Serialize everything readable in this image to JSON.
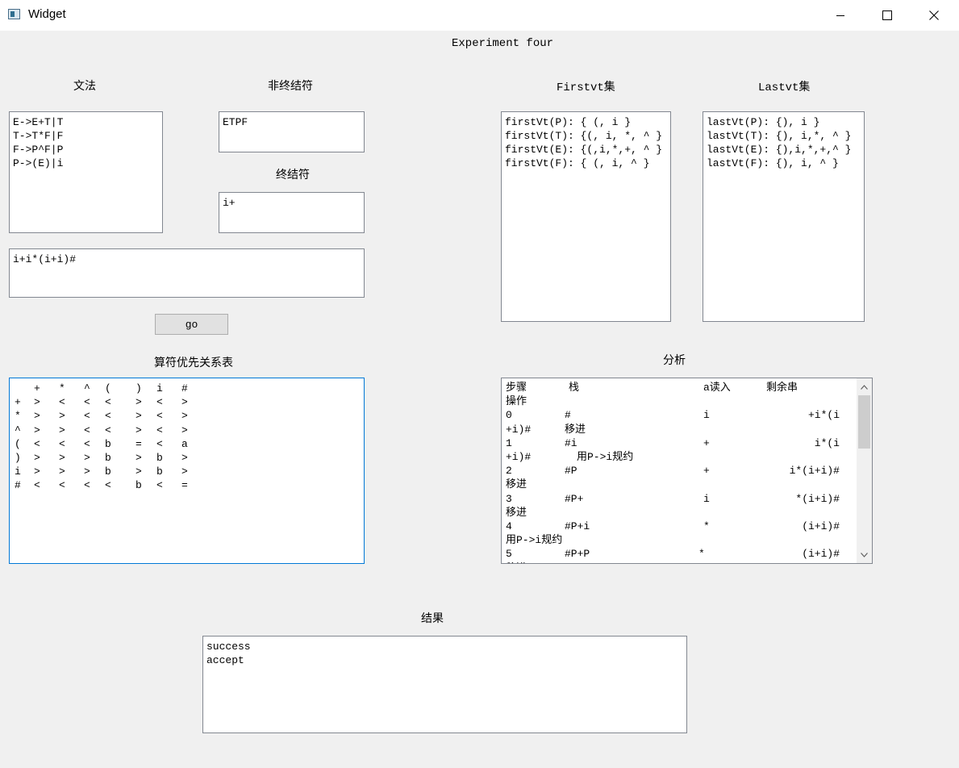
{
  "window": {
    "title": "Widget",
    "controls": [
      "minimize-icon",
      "maximize-icon",
      "close-icon"
    ]
  },
  "header": {
    "title": "Experiment four"
  },
  "grammar": {
    "label": "文法",
    "lines": [
      "E->E+T|T",
      "T->T*F|F",
      "F->P^F|P",
      "P->(E)|i"
    ]
  },
  "nonterminals": {
    "label": "非终结符",
    "value": "ETPF"
  },
  "terminals": {
    "label": "终结符",
    "value": "i+"
  },
  "input": {
    "value": "i+i*(i+i)#"
  },
  "go_button": {
    "label": "go"
  },
  "firstvt": {
    "label": "Firstvt集",
    "lines": [
      "firstVt(P): { (, i }",
      "firstVt(T): {(, i, *, ^ }",
      "firstVt(E): {(,i,*,+, ^ }",
      "firstVt(F): { (, i, ^ }"
    ]
  },
  "lastvt": {
    "label": "Lastvt集",
    "lines": [
      "lastVt(P): {), i }",
      "lastVt(T): {), i,*, ^ }",
      "lastVt(E): {),i,*,+,^ }",
      "lastVt(F): {), i, ^ }"
    ]
  },
  "precedence": {
    "label": "算符优先关系表",
    "header": [
      "",
      "+",
      "*",
      "^",
      "(",
      ")",
      "i",
      "#"
    ],
    "rows": [
      [
        "+",
        ">",
        "<",
        "<",
        "<",
        ">",
        "<",
        ">"
      ],
      [
        "*",
        ">",
        ">",
        "<",
        "<",
        ">",
        "<",
        ">"
      ],
      [
        "^",
        ">",
        ">",
        "<",
        "<",
        ">",
        "<",
        ">"
      ],
      [
        "(",
        "<",
        "<",
        "<",
        "b",
        "=",
        "<",
        "a"
      ],
      [
        ")",
        ">",
        ">",
        ">",
        "b",
        ">",
        "b",
        ">"
      ],
      [
        "i",
        ">",
        ">",
        ">",
        "b",
        ">",
        "b",
        ">"
      ],
      [
        "#",
        "<",
        "<",
        "<",
        "<",
        "b",
        "<",
        "="
      ]
    ]
  },
  "analysis": {
    "label": "分析",
    "header": {
      "step": "步骤",
      "stack": "栈",
      "read": "a读入",
      "rest": "剩余串",
      "action": "操作"
    },
    "rows": [
      {
        "step": "0",
        "stack": "#",
        "read": "i",
        "rest": "+i*(i",
        "rest2": "+i)#",
        "action": "移进"
      },
      {
        "step": "1",
        "stack": "#i",
        "read": "+",
        "rest": "i*(i",
        "rest2": "+i)#",
        "action": "用P->i规约"
      },
      {
        "step": "2",
        "stack": "#P",
        "read": "+",
        "rest": "i*(i+i)#",
        "rest2": "",
        "action": "移进"
      },
      {
        "step": "3",
        "stack": "#P+",
        "read": "i",
        "rest": "*(i+i)#",
        "rest2": "",
        "action": "移进"
      },
      {
        "step": "4",
        "stack": "#P+i",
        "read": "*",
        "rest": "(i+i)#",
        "rest2": "",
        "action": "用P->i规约"
      },
      {
        "step": "5",
        "stack": "#P+P",
        "read": "*",
        "rest": "(i+i)#",
        "rest2": "",
        "action": "移进"
      }
    ]
  },
  "result": {
    "label": "结果",
    "lines": [
      "success",
      "accept"
    ]
  }
}
